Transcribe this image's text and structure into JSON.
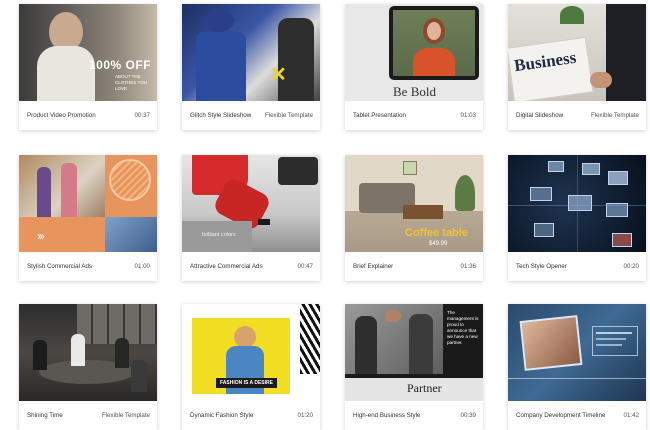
{
  "templates": [
    {
      "title": "Product Video Promotion",
      "meta": "00:37",
      "overlay": "100% OFF",
      "overlay_sub": "ABOUT THE CLOTHES YOU LOVE"
    },
    {
      "title": "Glitch Style Slideshow",
      "meta": "Flexible Template"
    },
    {
      "title": "Tablet Presentation",
      "meta": "01:03",
      "overlay": "Be Bold"
    },
    {
      "title": "Digital Slideshow",
      "meta": "Flexible Template",
      "overlay": "Business"
    },
    {
      "title": "Stylish Commercial Ads",
      "meta": "01:00"
    },
    {
      "title": "Attractive Commercial Ads",
      "meta": "00:47",
      "overlay": "brilliant colors"
    },
    {
      "title": "Brief Explainer",
      "meta": "01:36",
      "overlay": "Coffee table",
      "overlay_sub": "$49.99"
    },
    {
      "title": "Tech Style Opener",
      "meta": "00:20"
    },
    {
      "title": "Shining Time",
      "meta": "Flexible Template"
    },
    {
      "title": "Dynamic Fashion Style",
      "meta": "01:20",
      "overlay": "FASHION IS A DESIRE"
    },
    {
      "title": "High-end Business Style",
      "meta": "00:39",
      "overlay": "Partner",
      "overlay_sub": "The management is proud to announce that we have a new partner."
    },
    {
      "title": "Company Development Timeline",
      "meta": "01:42"
    }
  ]
}
